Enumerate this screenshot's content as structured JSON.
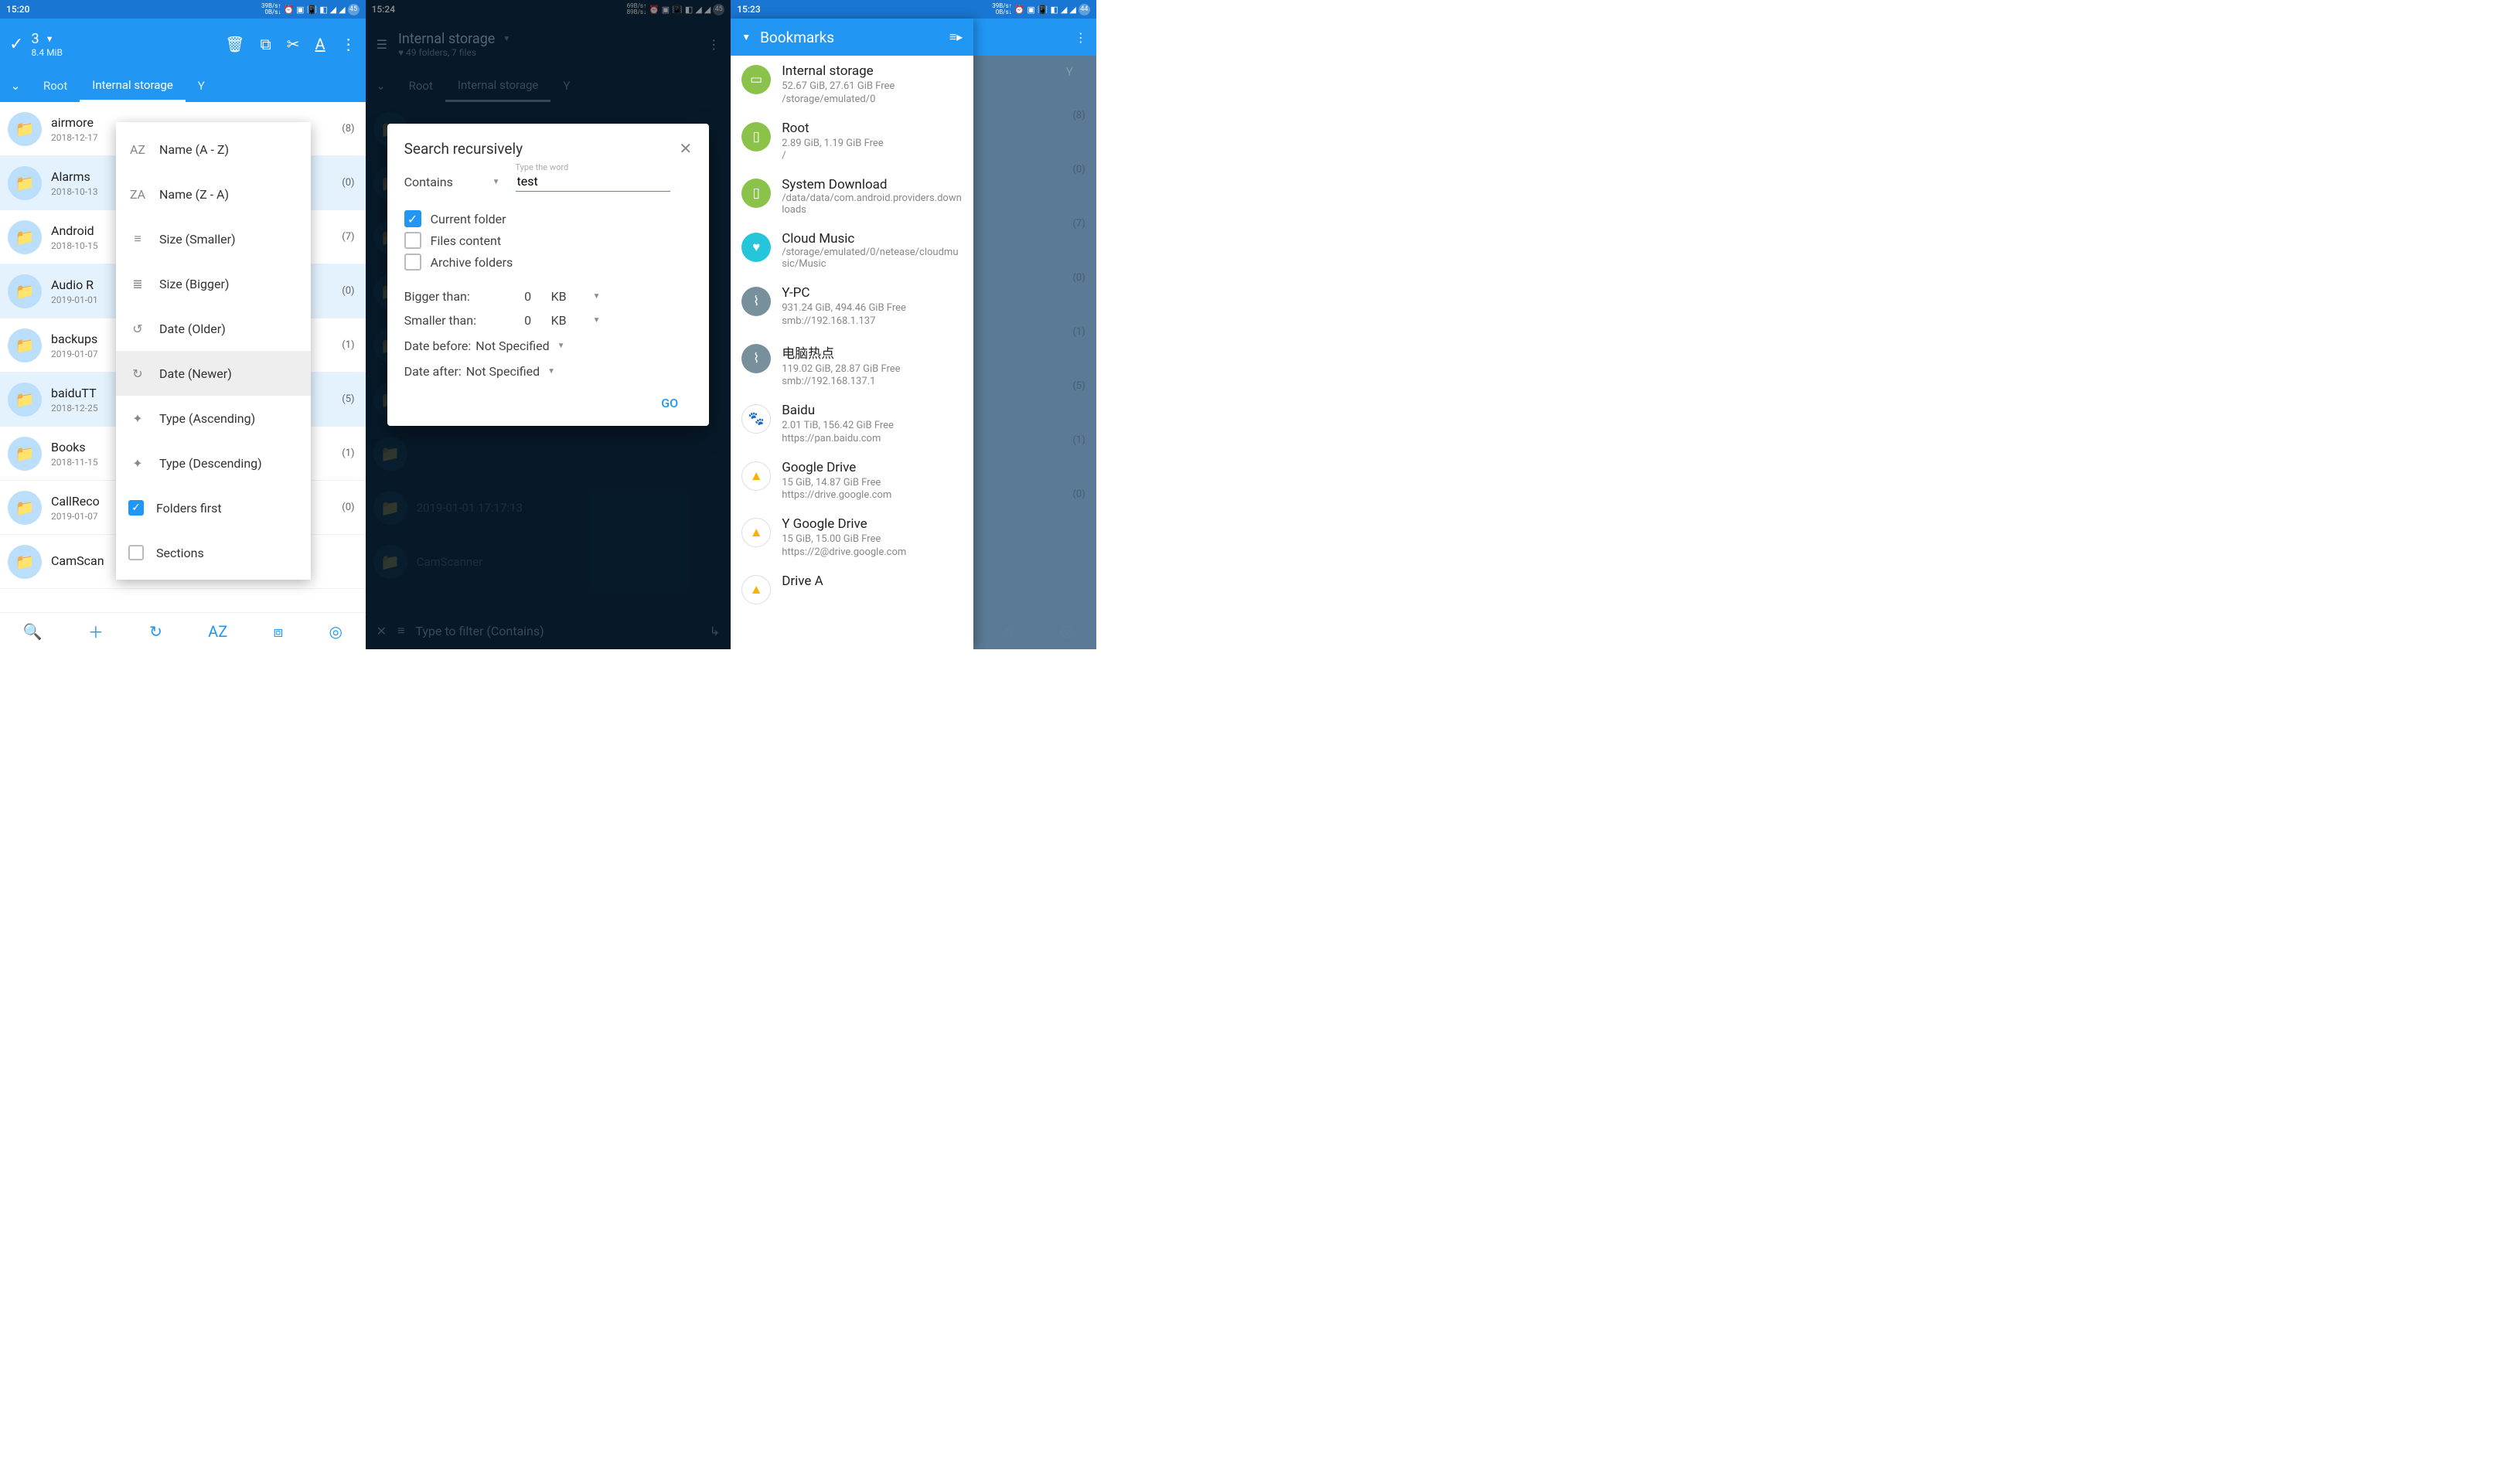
{
  "s1": {
    "status": {
      "time": "15:20",
      "speed_up": "39B/s",
      "speed_dn": "0B/s",
      "badge": "45"
    },
    "toolbar": {
      "count": "3",
      "size": "8.4 MiB"
    },
    "tabs": {
      "root": "Root",
      "internal": "Internal storage",
      "y": "Y"
    },
    "sort": {
      "name_az": "Name (A - Z)",
      "name_za": "Name (Z - A)",
      "size_small": "Size (Smaller)",
      "size_big": "Size (Bigger)",
      "date_old": "Date (Older)",
      "date_new": "Date (Newer)",
      "type_asc": "Type (Ascending)",
      "type_desc": "Type (Descending)",
      "folders_first": "Folders first",
      "sections": "Sections"
    },
    "rows": [
      {
        "name": "airmore",
        "date": "2018-12-17",
        "cnt": "(8)",
        "sel": false
      },
      {
        "name": "Alarms",
        "date": "2018-10-13",
        "cnt": "(0)",
        "sel": true
      },
      {
        "name": "Android",
        "date": "2018-10-15",
        "cnt": "(7)",
        "sel": false
      },
      {
        "name": "Audio R",
        "date": "2019-01-01",
        "cnt": "(0)",
        "sel": true
      },
      {
        "name": "backups",
        "date": "2019-01-07",
        "cnt": "(1)",
        "sel": false
      },
      {
        "name": "baiduTT",
        "date": "2018-12-25",
        "cnt": "(5)",
        "sel": true
      },
      {
        "name": "Books",
        "date": "2018-11-15",
        "cnt": "(1)",
        "sel": false
      },
      {
        "name": "CallReco",
        "date": "2019-01-07",
        "cnt": "(0)",
        "sel": false
      },
      {
        "name": "CamScan",
        "date": "",
        "cnt": "",
        "sel": false
      }
    ]
  },
  "s2": {
    "status": {
      "time": "15:24",
      "speed_up": "69B/s",
      "speed_dn": "89B/s",
      "badge": "45"
    },
    "toolbar": {
      "title": "Internal storage",
      "sub": "♥ 49 folders, 7 files"
    },
    "tabs": {
      "root": "Root",
      "internal": "Internal storage",
      "y": "Y"
    },
    "dialog": {
      "title": "Search recursively",
      "contains_label": "Contains",
      "contains_hint": "Type the word",
      "contains_value": "test",
      "cb_current": "Current folder",
      "cb_files": "Files content",
      "cb_archive": "Archive folders",
      "bigger_label": "Bigger than:",
      "bigger_val": "0",
      "bigger_unit": "KB",
      "smaller_label": "Smaller than:",
      "smaller_val": "0",
      "smaller_unit": "KB",
      "date_before_label": "Date before:",
      "date_before_val": "Not Specified",
      "date_after_label": "Date after:",
      "date_after_val": "Not Specified",
      "go": "GO"
    },
    "bg_row": {
      "name": "CamScanner",
      "date": "2019-01-01 17:17:13"
    },
    "filter_placeholder": "Type to filter (Contains)"
  },
  "s3": {
    "status": {
      "time": "15:23",
      "speed_up": "39B/s",
      "speed_dn": "0B/s",
      "badge": "44"
    },
    "drawer_title": "Bookmarks",
    "tabs": {
      "y": "Y"
    },
    "bookmarks": [
      {
        "name": "Internal storage",
        "det": "52.67 GiB,  27.61 GiB Free",
        "path": "/storage/emulated/0",
        "ico": "green",
        "glyph": "▭"
      },
      {
        "name": "Root",
        "det": "2.89 GiB,  1.19 GiB Free",
        "path": "/",
        "ico": "green",
        "glyph": "▯"
      },
      {
        "name": "System Download",
        "det": "",
        "path": "/data/data/com.android.providers.downloads",
        "ico": "green",
        "glyph": "▯"
      },
      {
        "name": "Cloud Music",
        "det": "",
        "path": "/storage/emulated/0/netease/cloudmusic/Music",
        "ico": "teal",
        "glyph": "♥"
      },
      {
        "name": "Y-PC",
        "det": "931.24 GiB,  494.46 GiB Free",
        "path": "smb://192.168.1.137",
        "ico": "gray",
        "glyph": "⌇"
      },
      {
        "name": "电脑热点",
        "det": "119.02 GiB,  28.87 GiB Free",
        "path": "smb://192.168.137.1",
        "ico": "gray",
        "glyph": "⌇"
      },
      {
        "name": "Baidu",
        "det": "2.01 TiB,  156.42 GiB Free",
        "path": "https://pan.baidu.com",
        "ico": "white",
        "glyph": "🐾"
      },
      {
        "name": "Google Drive",
        "det": "15 GiB,  14.87 GiB Free",
        "path": "https://drive.google.com",
        "ico": "white",
        "glyph": "▲"
      },
      {
        "name": "Y Google Drive",
        "det": "15 GiB,  15.00 GiB Free",
        "path": "https://2@drive.google.com",
        "ico": "white",
        "glyph": "▲"
      },
      {
        "name": "Drive A",
        "det": "",
        "path": "",
        "ico": "white",
        "glyph": "▲"
      }
    ],
    "bg_counts": [
      "(8)",
      "(0)",
      "(7)",
      "(0)",
      "(1)",
      "(5)",
      "(1)",
      "(0)"
    ]
  }
}
